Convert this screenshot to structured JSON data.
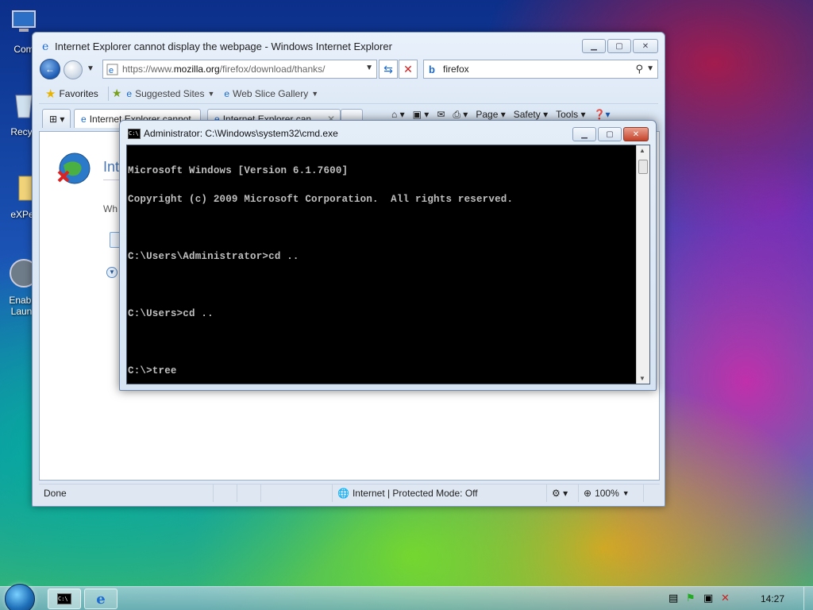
{
  "desktop": {
    "icons": [
      {
        "label": "Com"
      },
      {
        "label": "Recyc"
      },
      {
        "label": "eXPer"
      },
      {
        "label": "Enable Launc"
      }
    ]
  },
  "ie": {
    "title": "Internet Explorer cannot display the webpage - Windows Internet Explorer",
    "address": {
      "prefix": "https://www.",
      "domain": "mozilla.org",
      "suffix": "/firefox/download/thanks/"
    },
    "search": "firefox",
    "favorites_label": "Favorites",
    "links": [
      "Suggested Sites",
      "Web Slice Gallery"
    ],
    "tabs": [
      "Internet Explorer cannot...",
      "Internet Explorer can..."
    ],
    "commands": [
      "Page",
      "Safety",
      "Tools"
    ],
    "content": {
      "heading": "Int",
      "body": "Wh"
    },
    "status": {
      "text": "Done",
      "zone": "Internet | Protected Mode: Off",
      "zoom": "100%"
    }
  },
  "cmd": {
    "title": "Administrator: C:\\Windows\\system32\\cmd.exe",
    "lines": [
      "Microsoft Windows [Version 6.1.7600]",
      "Copyright (c) 2009 Microsoft Corporation.  All rights reserved.",
      "",
      "C:\\Users\\Administrator>cd ..",
      "",
      "C:\\Users>cd ..",
      "",
      "C:\\>tree"
    ]
  },
  "taskbar": {
    "clock": "14:27"
  },
  "colors": {
    "console_bg": "#000000",
    "console_fg": "#c0c0c0",
    "accent": "#1d5bb3"
  }
}
